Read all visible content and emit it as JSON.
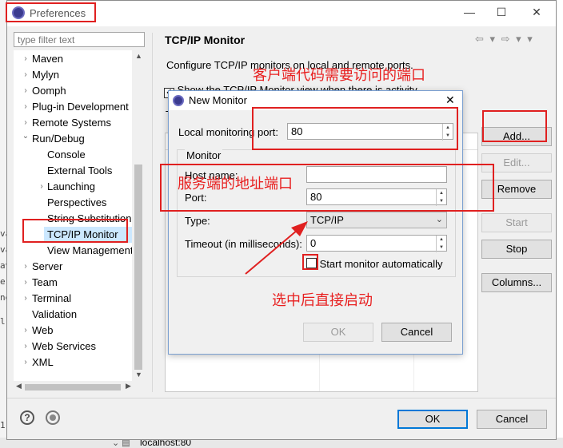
{
  "background": {
    "left_fragments": [
      "va",
      "va",
      "av",
      "e",
      "ne",
      "l",
      "1."
    ],
    "bottom_text": "localhost:80"
  },
  "window": {
    "title": "Preferences",
    "minimize": "—",
    "maximize": "☐",
    "close": "✕"
  },
  "sidebar": {
    "filter_placeholder": "type filter text",
    "items": [
      {
        "label": "Maven",
        "arrow": "›"
      },
      {
        "label": "Mylyn",
        "arrow": "›"
      },
      {
        "label": "Oomph",
        "arrow": "›"
      },
      {
        "label": "Plug-in Development",
        "arrow": "›"
      },
      {
        "label": "Remote Systems",
        "arrow": "›"
      },
      {
        "label": "Run/Debug",
        "arrow": "⌄"
      },
      {
        "label": "Console",
        "arrow": ""
      },
      {
        "label": "External Tools",
        "arrow": ""
      },
      {
        "label": "Launching",
        "arrow": "›"
      },
      {
        "label": "Perspectives",
        "arrow": ""
      },
      {
        "label": "String Substitution",
        "arrow": ""
      },
      {
        "label": "TCP/IP Monitor",
        "arrow": ""
      },
      {
        "label": "View Management",
        "arrow": ""
      },
      {
        "label": "Server",
        "arrow": "›"
      },
      {
        "label": "Team",
        "arrow": "›"
      },
      {
        "label": "Terminal",
        "arrow": "›"
      },
      {
        "label": "Validation",
        "arrow": ""
      },
      {
        "label": "Web",
        "arrow": "›"
      },
      {
        "label": "Web Services",
        "arrow": "›"
      },
      {
        "label": "XML",
        "arrow": "›"
      }
    ]
  },
  "page": {
    "title": "TCP/IP Monitor",
    "nav_icons": "⇦ ▾ ⇨ ▾ ▾",
    "description": "Configure TCP/IP monitors on local and remote ports.",
    "show_view_label": "Show the TCP/IP Monitor view when there is activity",
    "table_label": "T"
  },
  "buttons": {
    "add": "Add...",
    "edit": "Edit...",
    "remove": "Remove",
    "start": "Start",
    "stop": "Stop",
    "columns": "Columns..."
  },
  "footer": {
    "help_icon": "?",
    "ok": "OK",
    "cancel": "Cancel"
  },
  "dialog": {
    "title": "New Monitor",
    "close": "✕",
    "local_port_label": "Local monitoring port:",
    "local_port_value": "80",
    "group_label": "Monitor",
    "host_label": "Host name:",
    "host_value": "",
    "port_label": "Port:",
    "port_value": "80",
    "type_label": "Type:",
    "type_value": "TCP/IP",
    "timeout_label": "Timeout (in milliseconds):",
    "timeout_value": "0",
    "start_auto_label": "Start monitor automatically",
    "ok": "OK",
    "cancel": "Cancel"
  },
  "annotations": {
    "client_port": "客户端代码需要访问的端口",
    "server_addr": "服务端的地址端口",
    "select_start": "选中后直接启动"
  },
  "colors": {
    "annotation_red": "#e02020",
    "selection_bg": "#cce8ff"
  }
}
